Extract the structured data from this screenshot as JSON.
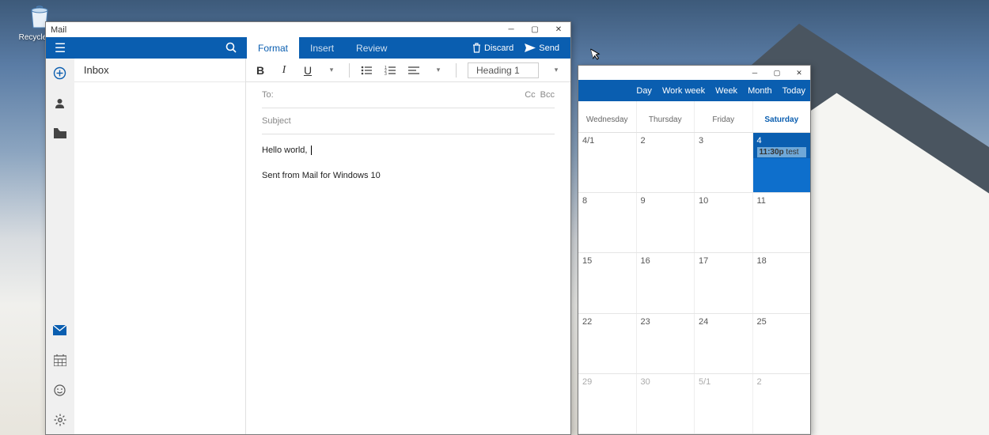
{
  "desktop": {
    "recycle_label": "Recycle Bin"
  },
  "mail": {
    "title": "Mail",
    "tabs": {
      "format": "Format",
      "insert": "Insert",
      "review": "Review"
    },
    "actions": {
      "discard": "Discard",
      "send": "Send"
    },
    "inbox_label": "Inbox",
    "format": {
      "heading": "Heading 1"
    },
    "fields": {
      "to": "To:",
      "cc": "Cc",
      "bcc": "Bcc",
      "subject": "Subject"
    },
    "body": {
      "line1": "Hello world,",
      "signature": "Sent from Mail for Windows 10"
    }
  },
  "calendar": {
    "views": {
      "day": "Day",
      "workweek": "Work week",
      "week": "Week",
      "month": "Month",
      "today": "Today"
    },
    "days": {
      "wed": "Wednesday",
      "thu": "Thursday",
      "fri": "Friday",
      "sat": "Saturday"
    },
    "rows": [
      {
        "wed": "4/1",
        "thu": "2",
        "fri": "3",
        "sat": "4",
        "event_time": "11:30p",
        "event_label": "test"
      },
      {
        "wed": "8",
        "thu": "9",
        "fri": "10",
        "sat": "11"
      },
      {
        "wed": "15",
        "thu": "16",
        "fri": "17",
        "sat": "18"
      },
      {
        "wed": "22",
        "thu": "23",
        "fri": "24",
        "sat": "25"
      },
      {
        "wed": "29",
        "thu": "30",
        "fri": "5/1",
        "sat": "2"
      }
    ]
  }
}
